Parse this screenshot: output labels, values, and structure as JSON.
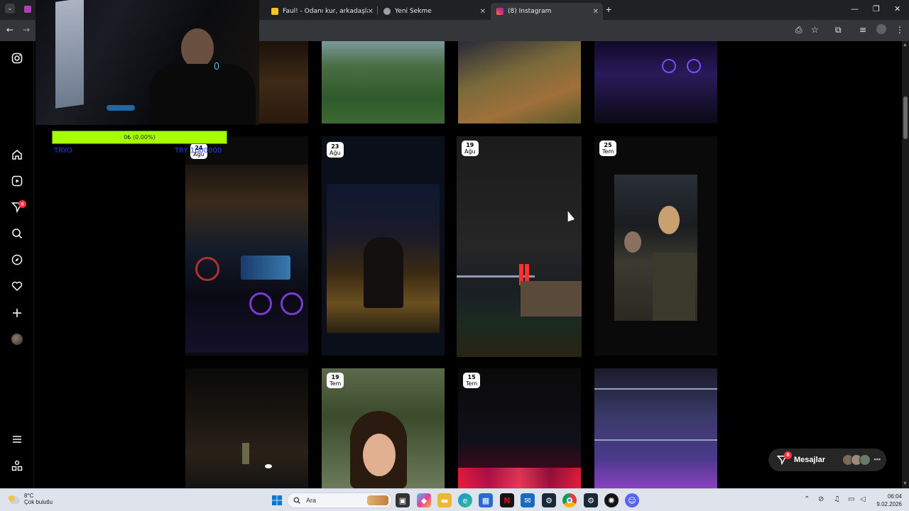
{
  "browser": {
    "tabs": [
      {
        "title": "Faul! - Odanı kur, arkadaşlarını...",
        "favicon_color": "#f5c518"
      },
      {
        "title": "Yeni Sekme",
        "favicon_color": "#9aa0a6"
      },
      {
        "title": "(8) Instagram",
        "favicon_color": "#e1306c"
      }
    ]
  },
  "overlay": {
    "progress_text": "0₺ (0.00%)",
    "progress_left": "TRYO",
    "progress_right": "TRY 1000000"
  },
  "sidebar": {
    "notification_count": "8",
    "items": [
      "instagram-logo",
      "home",
      "reels",
      "messages",
      "search",
      "explore",
      "notifications",
      "create",
      "profile",
      "more",
      "meta"
    ]
  },
  "grid": {
    "rows": [
      [
        {
          "date": "",
          "month": "",
          "top_colors": [
            "#2a1d12",
            "#6b4a22"
          ]
        },
        {
          "date": "",
          "month": "",
          "top_colors": [
            "#3c6a33",
            "#6f8f5c"
          ]
        },
        {
          "date": "",
          "month": "",
          "top_colors": [
            "#5a4a22",
            "#8c7a3a"
          ]
        },
        {
          "date": "",
          "month": "",
          "top_colors": [
            "#1a1030",
            "#3b2a6b"
          ]
        }
      ],
      [
        {
          "date": "24",
          "month": "Ağu"
        },
        {
          "date": "23",
          "month": "Ağu"
        },
        {
          "date": "19",
          "month": "Ağu"
        },
        {
          "date": "25",
          "month": "Tem"
        }
      ],
      [
        {
          "date": "",
          "month": ""
        },
        {
          "date": "19",
          "month": "Tem"
        },
        {
          "date": "15",
          "month": "Tem"
        },
        {
          "date": "",
          "month": ""
        }
      ]
    ]
  },
  "messages": {
    "label": "Mesajlar",
    "badge": "8"
  },
  "taskbar": {
    "weather_temp": "8°C",
    "weather_desc": "Çok bulutlu",
    "search_placeholder": "Ara",
    "time": "06:04",
    "date": "9.02.2026"
  }
}
